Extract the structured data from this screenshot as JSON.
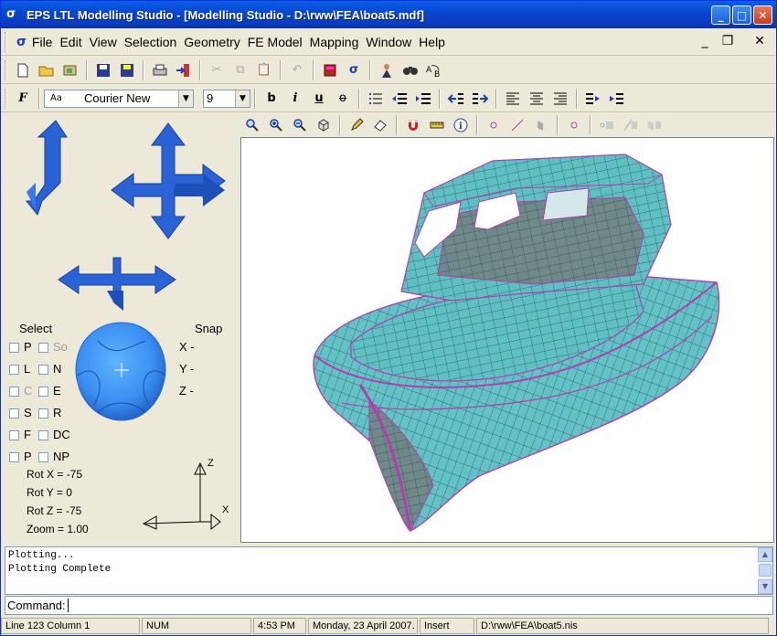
{
  "titlebar": {
    "title": "EPS LTL Modelling Studio - [Modelling Studio - D:\\rww\\FEA\\boat5.mdf]",
    "minimize": "_",
    "maximize": "□",
    "close": "✕"
  },
  "menu": {
    "items": [
      "File",
      "Edit",
      "View",
      "Selection",
      "Geometry",
      "FE Model",
      "Mapping",
      "Window",
      "Help"
    ],
    "child_minimize": "_",
    "child_restore": "❐",
    "child_close": "✕"
  },
  "format_toolbar": {
    "font_name": "Courier New",
    "font_size": "9",
    "font_preview": "Aa"
  },
  "left_panel": {
    "select_label": "Select",
    "snap_label": "Snap",
    "select_rows": [
      {
        "a": "P",
        "b": "So",
        "b_disabled": true
      },
      {
        "a": "L",
        "b": "N",
        "b_disabled": false
      },
      {
        "a": "C",
        "b": "E",
        "a_disabled": true
      },
      {
        "a": "S",
        "b": "R"
      },
      {
        "a": "F",
        "b": "DC"
      },
      {
        "a": "P",
        "b": "NP"
      }
    ],
    "snap_rows": [
      "X -",
      "Y -",
      "Z -"
    ],
    "rot_x": "Rot X = -75",
    "rot_y": "Rot Y = 0",
    "rot_z": "Rot Z = -75",
    "zoom": "Zoom = 1.00",
    "axis_z": "Z",
    "axis_x": "X"
  },
  "output": {
    "lines": [
      "Plotting...",
      "Plotting Complete"
    ],
    "command_label": "Command:"
  },
  "status": {
    "line_col": "Line 123  Column 1",
    "num": "NUM",
    "time": "4:53 PM",
    "date": "Monday, 23 April 2007.",
    "mode": "Insert",
    "file": "D:\\rww\\FEA\\boat5.nis"
  },
  "colors": {
    "mesh_face": "#5fc0c4",
    "mesh_edge": "#b53bb5",
    "arrow_blue": "#2a63d6"
  }
}
